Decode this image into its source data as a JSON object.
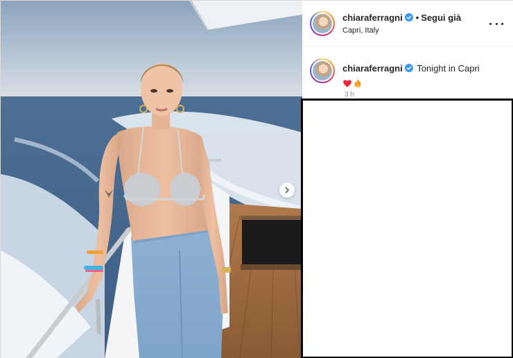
{
  "post": {
    "photo": {
      "description_icon": "photo",
      "next_icon": "chevron-right-icon"
    },
    "header": {
      "username": "chiaraferragni",
      "verified_icon": "verified-badge-icon",
      "separator": "•",
      "follow_status": "Segui già",
      "location": "Capri, Italy",
      "more_icon": "more-horizontal-icon"
    },
    "caption": {
      "username": "chiaraferragni",
      "text": "Tonight in Capri",
      "emojis": [
        "heart",
        "fire"
      ],
      "timestamp": "3 h"
    },
    "colors": {
      "verified": "#3897f0",
      "heart": "#ed2939",
      "text": "#262626",
      "muted": "#8e8e8e"
    }
  }
}
